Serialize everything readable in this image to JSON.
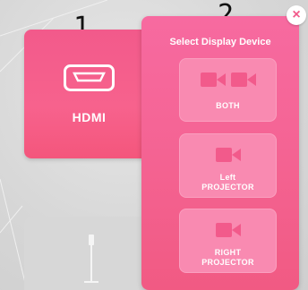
{
  "annotations": {
    "one": "1",
    "two": "2"
  },
  "source": {
    "hdmi_label": "HDMI"
  },
  "panel": {
    "title": "Select Display Device",
    "close_glyph": "×",
    "options": [
      {
        "line1": "BOTH",
        "line2": "",
        "icon": "two-camera-icon"
      },
      {
        "line1": "Left",
        "line2": "PROJECTOR",
        "icon": "camera-icon"
      },
      {
        "line1": "RIGHT",
        "line2": "PROJECTOR",
        "icon": "camera-icon"
      }
    ]
  },
  "colors": {
    "accent": "#f25a8b",
    "option_bg": "#f98ab1",
    "icon_fill": "#f25a8b"
  }
}
